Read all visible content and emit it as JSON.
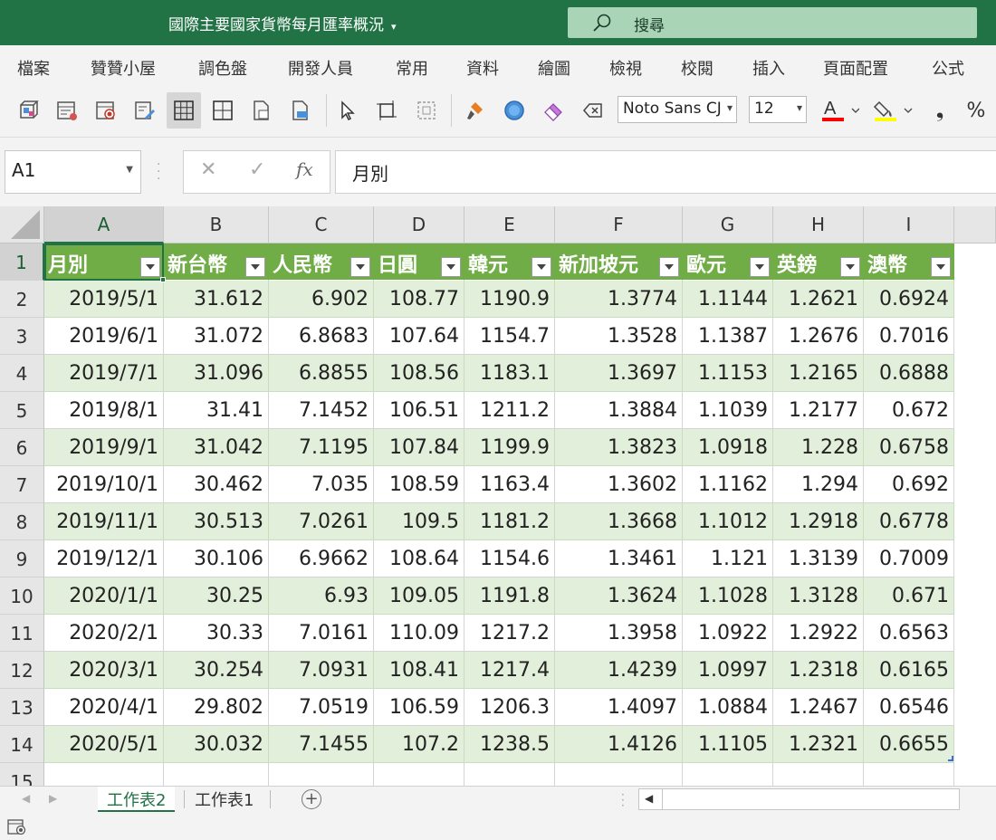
{
  "titlebar": {
    "doc_title": "國際主要國家貨幣每月匯率概況",
    "caret": "▾",
    "search_label": "搜尋",
    "bg_color": "#217346"
  },
  "menu": [
    "檔案",
    "贊贊小屋",
    "調色盤",
    "開發人員",
    "常用",
    "資料",
    "繪圖",
    "檢視",
    "校閱",
    "插入",
    "頁面配置",
    "公式"
  ],
  "toolbar": {
    "font_name": "Noto Sans CJ",
    "font_size": "12",
    "font_color": "#ff0000",
    "highlight_color": "#ffff00",
    "comma_label": "❟",
    "percent_label": "%"
  },
  "formula_bar": {
    "cell_ref": "A1",
    "fx_label": "fx",
    "cancel_label": "✕",
    "enter_label": "✓",
    "content": "月別"
  },
  "columns": [
    "A",
    "B",
    "C",
    "D",
    "E",
    "F",
    "G",
    "H",
    "I"
  ],
  "row_numbers": [
    "1",
    "2",
    "3",
    "4",
    "5",
    "6",
    "7",
    "8",
    "9",
    "10",
    "11",
    "12",
    "13",
    "14",
    "15"
  ],
  "table": {
    "style_color": "#70ad47",
    "band_color": "#e2efda",
    "headers": [
      "月別",
      "新台幣",
      "人民幣",
      "日圓",
      "韓元",
      "新加坡元",
      "歐元",
      "英鎊",
      "澳幣"
    ],
    "rows": [
      [
        "2019/5/1",
        "31.612",
        "6.902",
        "108.77",
        "1190.9",
        "1.3774",
        "1.1144",
        "1.2621",
        "0.6924"
      ],
      [
        "2019/6/1",
        "31.072",
        "6.8683",
        "107.64",
        "1154.7",
        "1.3528",
        "1.1387",
        "1.2676",
        "0.7016"
      ],
      [
        "2019/7/1",
        "31.096",
        "6.8855",
        "108.56",
        "1183.1",
        "1.3697",
        "1.1153",
        "1.2165",
        "0.6888"
      ],
      [
        "2019/8/1",
        "31.41",
        "7.1452",
        "106.51",
        "1211.2",
        "1.3884",
        "1.1039",
        "1.2177",
        "0.672"
      ],
      [
        "2019/9/1",
        "31.042",
        "7.1195",
        "107.84",
        "1199.9",
        "1.3823",
        "1.0918",
        "1.228",
        "0.6758"
      ],
      [
        "2019/10/1",
        "30.462",
        "7.035",
        "108.59",
        "1163.4",
        "1.3602",
        "1.1162",
        "1.294",
        "0.692"
      ],
      [
        "2019/11/1",
        "30.513",
        "7.0261",
        "109.5",
        "1181.2",
        "1.3668",
        "1.1012",
        "1.2918",
        "0.6778"
      ],
      [
        "2019/12/1",
        "30.106",
        "6.9662",
        "108.64",
        "1154.6",
        "1.3461",
        "1.121",
        "1.3139",
        "0.7009"
      ],
      [
        "2020/1/1",
        "30.25",
        "6.93",
        "109.05",
        "1191.8",
        "1.3624",
        "1.1028",
        "1.3128",
        "0.671"
      ],
      [
        "2020/2/1",
        "30.33",
        "7.0161",
        "110.09",
        "1217.2",
        "1.3958",
        "1.0922",
        "1.2922",
        "0.6563"
      ],
      [
        "2020/3/1",
        "30.254",
        "7.0931",
        "108.41",
        "1217.4",
        "1.4239",
        "1.0997",
        "1.2318",
        "0.6165"
      ],
      [
        "2020/4/1",
        "29.802",
        "7.0519",
        "106.59",
        "1206.3",
        "1.4097",
        "1.0884",
        "1.2467",
        "0.6546"
      ],
      [
        "2020/5/1",
        "30.032",
        "7.1455",
        "107.2",
        "1238.5",
        "1.4126",
        "1.1105",
        "1.2321",
        "0.6655"
      ]
    ]
  },
  "sheet_tabs": [
    "工作表2",
    "工作表1"
  ],
  "add_sheet_label": "+"
}
